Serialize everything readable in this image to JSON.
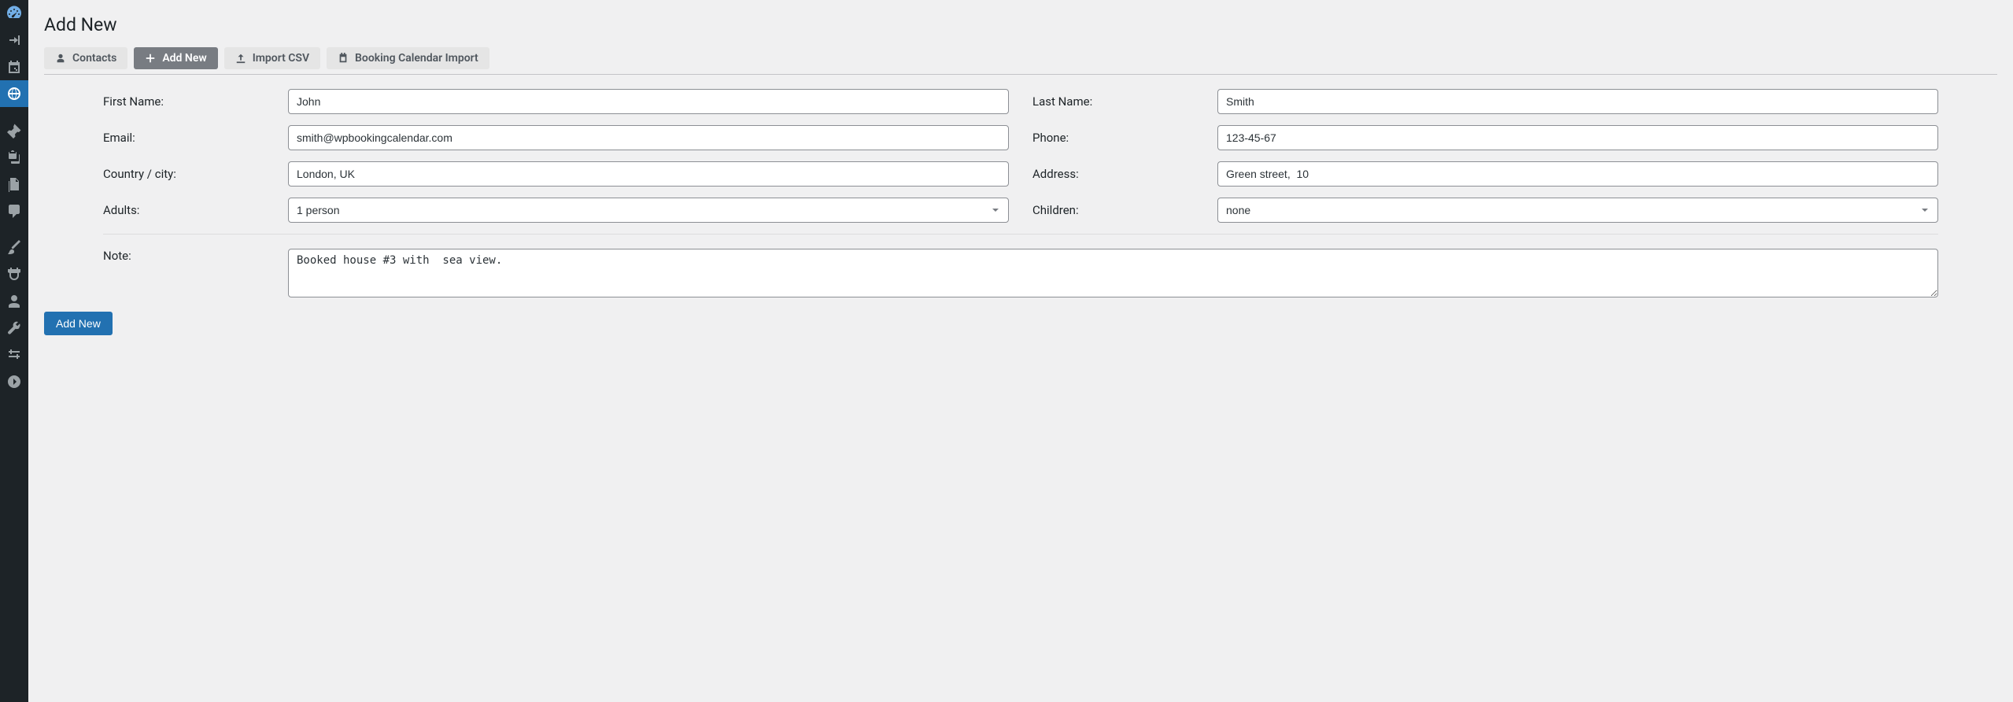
{
  "page": {
    "title": "Add New"
  },
  "tabs": {
    "contacts": {
      "label": "Contacts"
    },
    "add_new": {
      "label": "Add New"
    },
    "import_csv": {
      "label": "Import CSV"
    },
    "booking": {
      "label": "Booking Calendar Import"
    }
  },
  "form": {
    "labels": {
      "first_name": "First Name:",
      "last_name": "Last Name:",
      "email": "Email:",
      "phone": "Phone:",
      "country": "Country / city:",
      "address": "Address:",
      "adults": "Adults:",
      "children": "Children:",
      "note": "Note:"
    },
    "values": {
      "first_name": "John",
      "last_name": "Smith",
      "email": "smith@wpbookingcalendar.com",
      "phone": "123-45-67",
      "country": "London, UK",
      "address": "Green street,  10",
      "adults": "1 person",
      "children": "none",
      "note": "Booked house #3 with  sea view."
    }
  },
  "buttons": {
    "submit": "Add New"
  }
}
